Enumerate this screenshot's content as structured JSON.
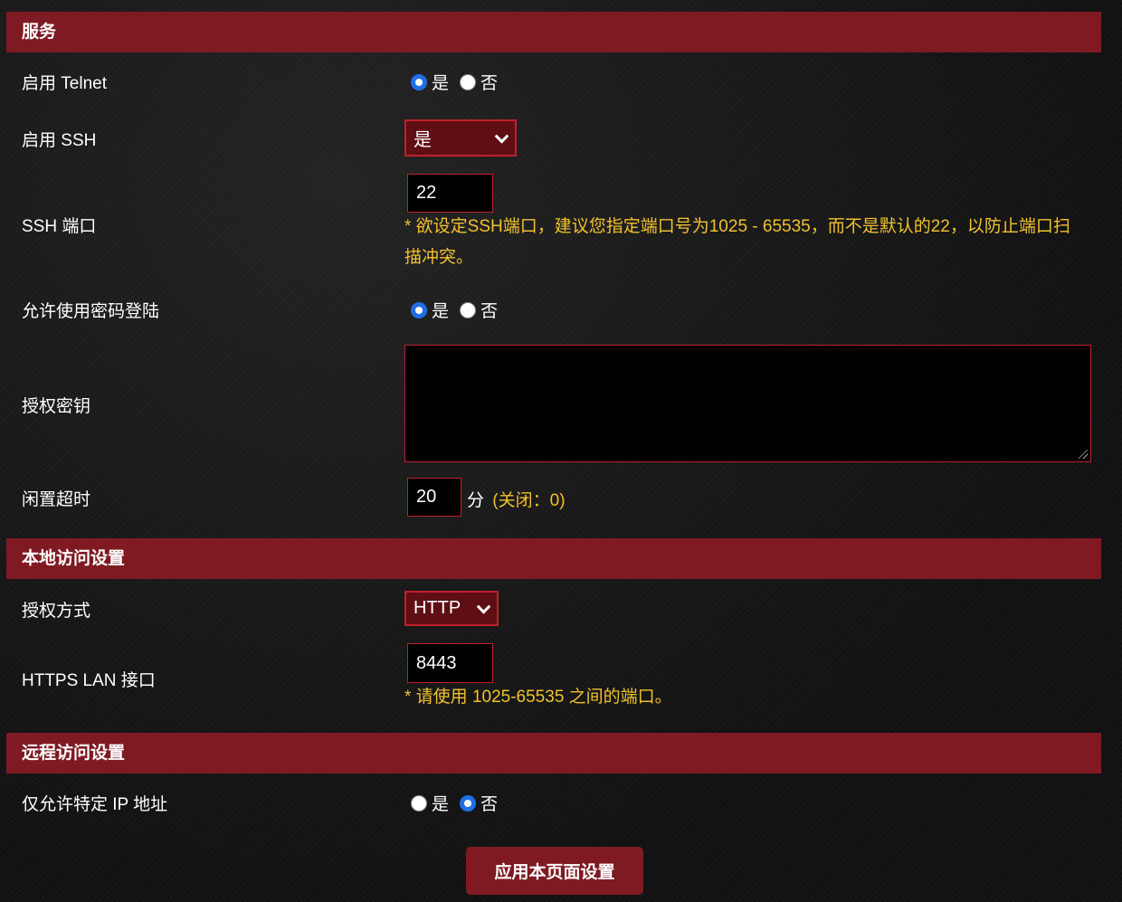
{
  "radio_yes": "是",
  "radio_no": "否",
  "services": {
    "header": "服务",
    "telnet": {
      "label": "启用 Telnet",
      "value": "是"
    },
    "ssh": {
      "label": "启用 SSH",
      "selected": "是"
    },
    "ssh_port": {
      "label": "SSH 端口",
      "value": "22",
      "hint_line1": "* 欲设定SSH端口，建议您指定端口号为1025 - 65535，而不是默认的22，以防止端口扫",
      "hint_line2": "描冲突。"
    },
    "password_login": {
      "label": "允许使用密码登陆",
      "value": "是"
    },
    "authorized_keys": {
      "label": "授权密钥",
      "value": ""
    },
    "idle_timeout": {
      "label": "闲置超时",
      "value": "20",
      "unit": "分",
      "hint": "(关闭：0)"
    }
  },
  "local_access": {
    "header": "本地访问设置",
    "auth_method": {
      "label": "授权方式",
      "selected": "HTTP"
    },
    "https_lan_port": {
      "label": "HTTPS LAN 接口",
      "value": "8443",
      "hint": "* 请使用 1025-65535 之间的端口。"
    }
  },
  "remote_access": {
    "header": "远程访问设置",
    "specific_ip": {
      "label": "仅允许特定 IP 地址",
      "value": "否"
    }
  },
  "apply_button": "应用本页面设置",
  "colors": {
    "header_bg": "#7f1a22",
    "hint_text": "#f2c12e",
    "radio_checked": "#1f6fe8",
    "input_border": "#c0202e"
  }
}
